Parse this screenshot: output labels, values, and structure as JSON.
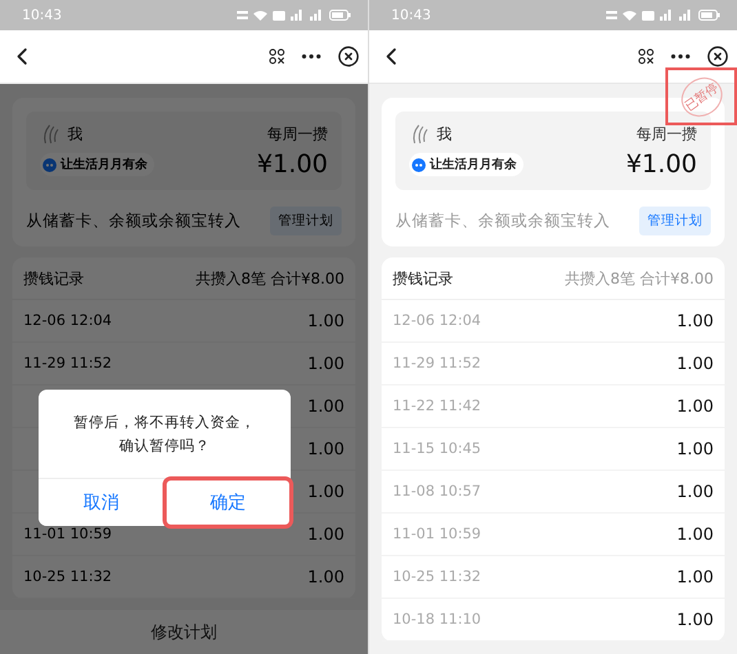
{
  "screens": [
    {
      "status_bar": {
        "time": "10:43"
      },
      "dimmed": true,
      "card": {
        "name": "我",
        "frequency": "每周一攒",
        "tag": "让生活月月有余",
        "amount": "¥1.00"
      },
      "source": {
        "text": "从储蓄卡、余额或余额宝转入",
        "button": "管理计划"
      },
      "records": {
        "title": "攒钱记录",
        "summary": "共攒入8笔 合计¥8.00",
        "rows": [
          {
            "time": "12-06 12:04",
            "amount": "1.00"
          },
          {
            "time": "11-29 11:52",
            "amount": "1.00"
          },
          {
            "amount": "1.00"
          },
          {
            "amount": "1.00"
          },
          {
            "amount": "1.00"
          },
          {
            "time": "11-01 10:59",
            "amount": "1.00"
          },
          {
            "time": "10-25 11:32",
            "amount": "1.00"
          }
        ]
      },
      "dialog": {
        "message": [
          "暂停后，将不再转入资金，",
          "确认暂停吗？"
        ],
        "buttons": [
          {
            "label": "取消",
            "kind": "cancel",
            "highlighted": false
          },
          {
            "label": "确定",
            "kind": "confirm",
            "highlighted": true
          }
        ]
      },
      "bottom_button": "修改计划"
    },
    {
      "status_bar": {
        "time": "10:43"
      },
      "dimmed": false,
      "card": {
        "name": "我",
        "frequency": "每周一攒",
        "tag": "让生活月月有余",
        "amount": "¥1.00"
      },
      "stamp": {
        "text": "已暂停",
        "highlighted": true
      },
      "source": {
        "text": "从储蓄卡、余额或余额宝转入",
        "button": "管理计划"
      },
      "records": {
        "title": "攒钱记录",
        "summary": "共攒入8笔 合计¥8.00",
        "rows": [
          {
            "time": "12-06 12:04",
            "amount": "1.00"
          },
          {
            "time": "11-29 11:52",
            "amount": "1.00"
          },
          {
            "time": "11-22 11:42",
            "amount": "1.00"
          },
          {
            "time": "11-15 10:45",
            "amount": "1.00"
          },
          {
            "time": "11-08 10:57",
            "amount": "1.00"
          },
          {
            "time": "11-01 10:59",
            "amount": "1.00"
          },
          {
            "time": "10-25 11:32",
            "amount": "1.00"
          },
          {
            "time": "10-18 11:10",
            "amount": "1.00"
          }
        ]
      }
    }
  ]
}
